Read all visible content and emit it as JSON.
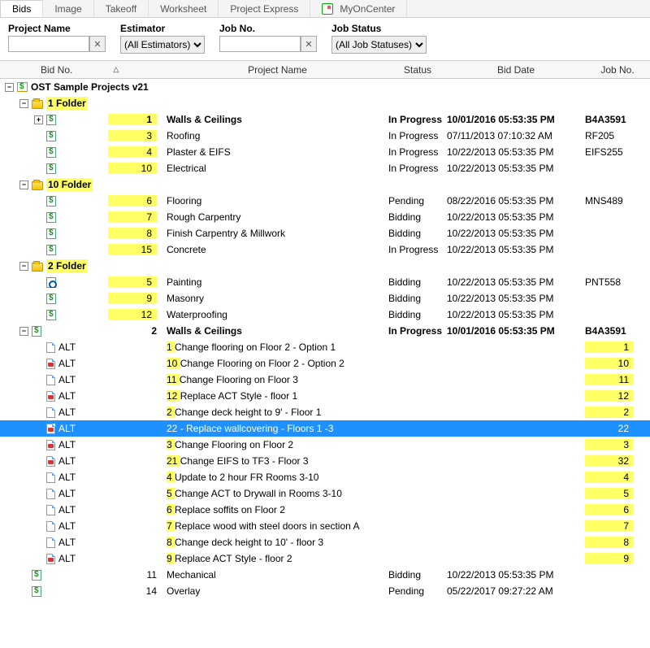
{
  "tabs": [
    "Bids",
    "Image",
    "Takeoff",
    "Worksheet",
    "Project Express",
    "MyOnCenter"
  ],
  "active_tab": 0,
  "filters": {
    "project_name_label": "Project Name",
    "project_name_value": "",
    "estimator_label": "Estimator",
    "estimator_value": "(All Estimators)",
    "jobno_label": "Job No.",
    "jobno_value": "",
    "jobstatus_label": "Job Status",
    "jobstatus_value": "(All Job Statuses)"
  },
  "columns": {
    "bidno": "Bid No.",
    "project_name": "Project Name",
    "status": "Status",
    "bid_date": "Bid Date",
    "job_no": "Job No."
  },
  "root_label": "OST Sample Projects v21",
  "rows": [
    {
      "type": "root",
      "indent": 0,
      "exp": "-",
      "icon": "db",
      "label": "OST Sample Projects v21",
      "bold": true
    },
    {
      "type": "folder",
      "indent": 1,
      "exp": "-",
      "icon": "folder",
      "label": "1 Folder",
      "bold": true,
      "hlLabel": true
    },
    {
      "type": "bid",
      "indent": 2,
      "exp": "+",
      "icon": "bid",
      "num": "1",
      "name": "Walls & Ceilings",
      "status": "In Progress",
      "date": "10/01/2016 05:53:35 PM",
      "job": "B4A3591",
      "bold": true,
      "hlNum": true
    },
    {
      "type": "bid",
      "indent": 2,
      "icon": "bid",
      "num": "3",
      "name": "Roofing",
      "status": "In Progress",
      "date": "07/11/2013 07:10:32 AM",
      "job": "RF205",
      "hlNum": true
    },
    {
      "type": "bid",
      "indent": 2,
      "icon": "bid",
      "num": "4",
      "name": "Plaster & EIFS",
      "status": "In Progress",
      "date": "10/22/2013 05:53:35 PM",
      "job": "EIFS255",
      "hlNum": true
    },
    {
      "type": "bid",
      "indent": 2,
      "icon": "bid",
      "num": "10",
      "name": "Electrical",
      "status": "In Progress",
      "date": "10/22/2013 05:53:35 PM",
      "job": "",
      "hlNum": true
    },
    {
      "type": "folder",
      "indent": 1,
      "exp": "-",
      "icon": "folder",
      "label": "10 Folder",
      "bold": true,
      "hlLabel": true
    },
    {
      "type": "bid",
      "indent": 2,
      "icon": "bid",
      "num": "6",
      "name": "Flooring",
      "status": "Pending",
      "date": "08/22/2016 05:53:35 PM",
      "job": "MNS489",
      "hlNum": true
    },
    {
      "type": "bid",
      "indent": 2,
      "icon": "bid",
      "num": "7",
      "name": "Rough Carpentry",
      "status": "Bidding",
      "date": "10/22/2013 05:53:35 PM",
      "job": "",
      "hlNum": true
    },
    {
      "type": "bid",
      "indent": 2,
      "icon": "bid",
      "num": "8",
      "name": "Finish Carpentry & Millwork",
      "status": "Bidding",
      "date": "10/22/2013 05:53:35 PM",
      "job": "",
      "hlNum": true
    },
    {
      "type": "bid",
      "indent": 2,
      "icon": "bid",
      "num": "15",
      "name": "Concrete",
      "status": "In Progress",
      "date": "10/22/2013 05:53:35 PM",
      "job": "",
      "hlNum": true
    },
    {
      "type": "folder",
      "indent": 1,
      "exp": "-",
      "icon": "folder",
      "label": "2 Folder",
      "bold": true,
      "hlLabel": true
    },
    {
      "type": "bid",
      "indent": 2,
      "icon": "bidring",
      "num": "5",
      "name": "Painting",
      "status": "Bidding",
      "date": "10/22/2013 05:53:35 PM",
      "job": "PNT558",
      "hlNum": true
    },
    {
      "type": "bid",
      "indent": 2,
      "icon": "bid",
      "num": "9",
      "name": "Masonry",
      "status": "Bidding",
      "date": "10/22/2013 05:53:35 PM",
      "job": "",
      "hlNum": true
    },
    {
      "type": "bid",
      "indent": 2,
      "icon": "bid",
      "num": "12",
      "name": "Waterproofing",
      "status": "Bidding",
      "date": "10/22/2013 05:53:35 PM",
      "job": "",
      "hlNum": true
    },
    {
      "type": "bid",
      "indent": 1,
      "exp": "-",
      "icon": "bid",
      "num": "2",
      "name": "Walls & Ceilings",
      "status": "In Progress",
      "date": "10/01/2016 05:53:35 PM",
      "job": "B4A3591",
      "bold": true
    },
    {
      "type": "alt",
      "indent": 2,
      "icon": "alt",
      "label": "ALT",
      "altnum": "1",
      "name": "Change flooring on Floor 2 - Option 1",
      "jobhl": "1"
    },
    {
      "type": "alt",
      "indent": 2,
      "icon": "altred",
      "label": "ALT",
      "altnum": "10",
      "name": "Change Flooring on Floor 2 - Option 2",
      "jobhl": "10"
    },
    {
      "type": "alt",
      "indent": 2,
      "icon": "alt",
      "label": "ALT",
      "altnum": "11",
      "name": "Change Flooring on Floor 3",
      "jobhl": "11"
    },
    {
      "type": "alt",
      "indent": 2,
      "icon": "altred",
      "label": "ALT",
      "altnum": "12",
      "name": "Replace ACT Style - floor 1",
      "jobhl": "12"
    },
    {
      "type": "alt",
      "indent": 2,
      "icon": "alt",
      "label": "ALT",
      "altnum": "2",
      "name": "Change deck height to 9' - Floor 1",
      "jobhl": "2"
    },
    {
      "type": "alt",
      "indent": 2,
      "icon": "altred",
      "label": "ALT",
      "altnum": "22",
      "name": "- Replace wallcovering - Floors 1 -3",
      "jobhl": "22",
      "selected": true
    },
    {
      "type": "alt",
      "indent": 2,
      "icon": "altred",
      "label": "ALT",
      "altnum": "3",
      "name": "Change Flooring on Floor 2",
      "jobhl": "3"
    },
    {
      "type": "alt",
      "indent": 2,
      "icon": "altred",
      "label": "ALT",
      "altnum": "21",
      "name": "Change EIFS to TF3 - Floor 3",
      "jobhl": "32"
    },
    {
      "type": "alt",
      "indent": 2,
      "icon": "alt",
      "label": "ALT",
      "altnum": "4",
      "name": "Update to 2 hour FR Rooms 3-10",
      "jobhl": "4"
    },
    {
      "type": "alt",
      "indent": 2,
      "icon": "alt",
      "label": "ALT",
      "altnum": "5",
      "name": "Change ACT to Drywall in Rooms 3-10",
      "jobhl": "5"
    },
    {
      "type": "alt",
      "indent": 2,
      "icon": "alt",
      "label": "ALT",
      "altnum": "6",
      "name": "Replace soffits on Floor 2",
      "jobhl": "6"
    },
    {
      "type": "alt",
      "indent": 2,
      "icon": "alt",
      "label": "ALT",
      "altnum": "7",
      "name": "Replace wood with steel doors in section A",
      "jobhl": "7"
    },
    {
      "type": "alt",
      "indent": 2,
      "icon": "alt",
      "label": "ALT",
      "altnum": "8",
      "name": "Change deck height to 10' - floor 3",
      "jobhl": "8"
    },
    {
      "type": "alt",
      "indent": 2,
      "icon": "altred",
      "label": "ALT",
      "altnum": "9",
      "name": "Replace ACT Style - floor 2",
      "jobhl": "9"
    },
    {
      "type": "bid",
      "indent": 1,
      "icon": "bid",
      "num": "11",
      "name": "Mechanical",
      "status": "Bidding",
      "date": "10/22/2013 05:53:35 PM",
      "job": ""
    },
    {
      "type": "bid",
      "indent": 1,
      "icon": "bid",
      "num": "14",
      "name": "Overlay",
      "status": "Pending",
      "date": "05/22/2017 09:27:22 AM",
      "job": ""
    }
  ]
}
